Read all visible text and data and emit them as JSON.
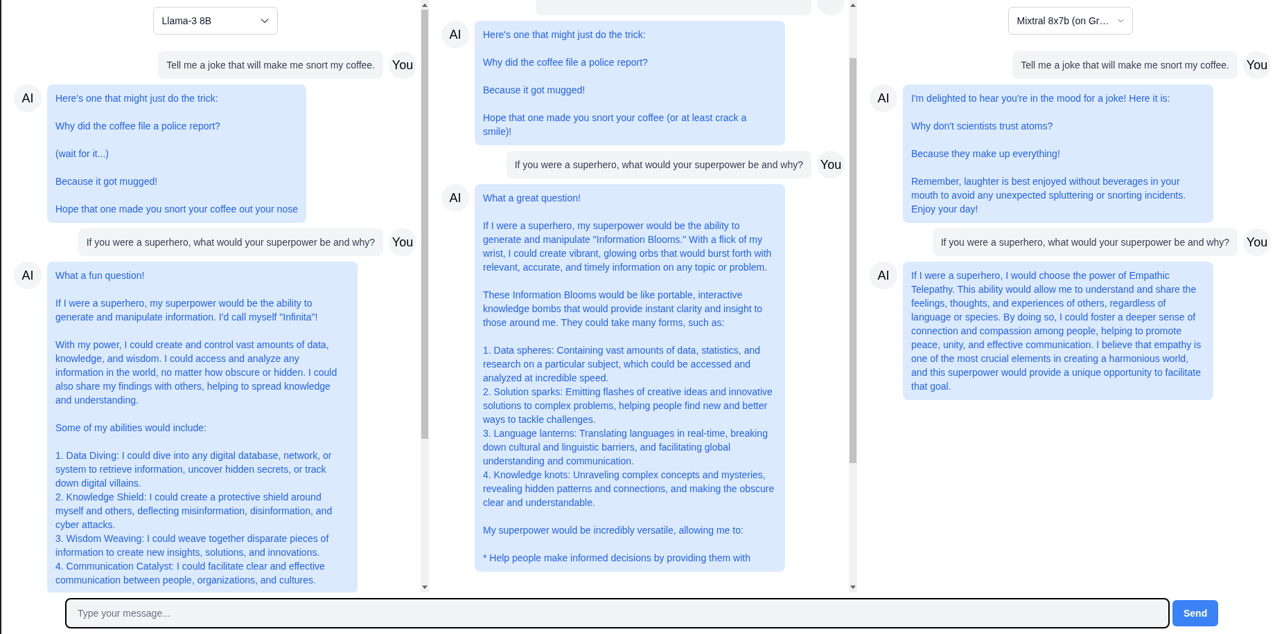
{
  "panels": [
    {
      "model": "Llama-3 8B",
      "scrollbar": true,
      "scrolled": false,
      "messages": [
        {
          "kind": "user",
          "avatar": "You",
          "text": "Tell me a joke that will make me snort my coffee."
        },
        {
          "kind": "ai",
          "avatar": "AI",
          "text": "Here's one that might just do the trick:\n\nWhy did the coffee file a police report?\n\n(wait for it...)\n\nBecause it got mugged!\n\nHope that one made you snort your coffee out your nose"
        },
        {
          "kind": "user",
          "avatar": "You",
          "text": "If you were a superhero, what would your superpower be and why?"
        },
        {
          "kind": "ai",
          "avatar": "AI",
          "text": "What a fun question!\n\nIf I were a superhero, my superpower would be the ability to generate and manipulate information. I'd call myself \"Infinita\"!\n\nWith my power, I could create and control vast amounts of data, knowledge, and wisdom. I could access and analyze any information in the world, no matter how obscure or hidden. I could also share my findings with others, helping to spread knowledge and understanding.\n\nSome of my abilities would include:\n\n1. Data Diving: I could dive into any digital database, network, or system to retrieve information, uncover hidden secrets, or track down digital villains.\n2. Knowledge Shield: I could create a protective shield around myself and others, deflecting misinformation, disinformation, and cyber attacks.\n3. Wisdom Weaving: I could weave together disparate pieces of information to create new insights, solutions, and innovations.\n4. Communication Catalyst: I could facilitate clear and effective communication between people, organizations, and cultures."
        }
      ]
    },
    {
      "scrollbar": true,
      "scrolled": true,
      "messages": [
        {
          "kind": "user",
          "cut": true
        },
        {
          "kind": "ai",
          "avatar": "AI",
          "text": "Here's one that might just do the trick:\n\nWhy did the coffee file a police report?\n\nBecause it got mugged!\n\nHope that one made you snort your coffee (or at least crack a smile)!"
        },
        {
          "kind": "user",
          "avatar": "You",
          "text": "If you were a superhero, what would your superpower be and why?"
        },
        {
          "kind": "ai",
          "avatar": "AI",
          "text": "What a great question!\n\nIf I were a superhero, my superpower would be the ability to generate and manipulate \"Information Blooms.\" With a flick of my wrist, I could create vibrant, glowing orbs that would burst forth with relevant, accurate, and timely information on any topic or problem.\n\nThese Information Blooms would be like portable, interactive knowledge bombs that would provide instant clarity and insight to those around me. They could take many forms, such as:\n\n1. Data spheres: Containing vast amounts of data, statistics, and research on a particular subject, which could be accessed and analyzed at incredible speed.\n2. Solution sparks: Emitting flashes of creative ideas and innovative solutions to complex problems, helping people find new and better ways to tackle challenges.\n3. Language lanterns: Translating languages in real-time, breaking down cultural and linguistic barriers, and facilitating global understanding and communication.\n4. Knowledge knots: Unraveling complex concepts and mysteries, revealing hidden patterns and connections, and making the obscure clear and understandable.\n\nMy superpower would be incredibly versatile, allowing me to:\n\n* Help people make informed decisions by providing them with"
        }
      ]
    },
    {
      "model": "Mixtral 8x7b (on Gr…",
      "messages": [
        {
          "kind": "user",
          "avatar": "You",
          "text": "Tell me a joke that will make me snort my coffee."
        },
        {
          "kind": "ai",
          "avatar": "AI",
          "text": "I'm delighted to hear you're in the mood for a joke! Here it is:\n\nWhy don't scientists trust atoms?\n\nBecause they make up everything!\n\nRemember, laughter is best enjoyed without beverages in your mouth to avoid any unexpected spluttering or snorting incidents. Enjoy your day!"
        },
        {
          "kind": "user",
          "avatar": "You",
          "text": "If you were a superhero, what would your superpower be and why?"
        },
        {
          "kind": "ai",
          "avatar": "AI",
          "text": "If I were a superhero, I would choose the power of Empathic Telepathy. This ability would allow me to understand and share the feelings, thoughts, and experiences of others, regardless of language or species. By doing so, I could foster a deeper sense of connection and compassion among people, helping to promote peace, unity, and effective communication. I believe that empathy is one of the most crucial elements in creating a harmonious world, and this superpower would provide a unique opportunity to facilitate that goal."
        }
      ]
    }
  ],
  "composer": {
    "placeholder": "Type your message...",
    "send": "Send"
  }
}
